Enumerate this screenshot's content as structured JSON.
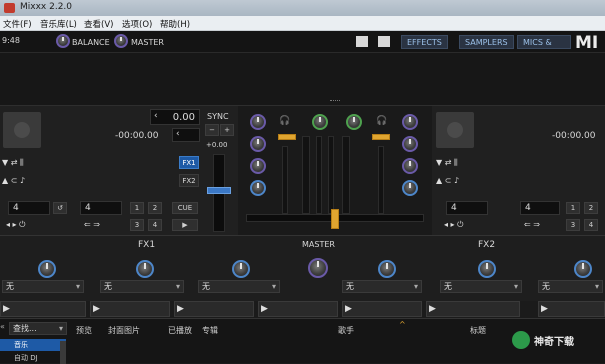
{
  "window": {
    "title": "Mixxx 2.2.0"
  },
  "menu": [
    {
      "label": "文件(F)"
    },
    {
      "label": "音乐库(L)"
    },
    {
      "label": "查看(V)"
    },
    {
      "label": "选项(O)"
    },
    {
      "label": "帮助(H)"
    }
  ],
  "topbar": {
    "clock": "9:48",
    "balance": "BALANCE",
    "master": "MASTER",
    "effects": "EFFECTS",
    "samplers": "SAMPLERS",
    "mics_aux": "MICS & AUX",
    "logo": "MI"
  },
  "deck_left": {
    "rate": "0.00",
    "time": "-00:00.00",
    "loop_size": "4",
    "beatjump_size": "4",
    "sync": "SYNC",
    "pitch": "+0.00",
    "fx1": "FX1",
    "fx2": "FX2",
    "cue": "CUE",
    "hotcues": [
      "1",
      "2",
      "3",
      "4"
    ]
  },
  "deck_right": {
    "time": "-00:00.00",
    "loop_size": "4",
    "beatjump_size": "4",
    "hotcues": [
      "1",
      "2",
      "3",
      "4"
    ]
  },
  "fx": {
    "unit1": "FX1",
    "unit2": "FX2",
    "master": "MASTER",
    "none": "无"
  },
  "library": {
    "search_placeholder": "查找...",
    "columns": [
      "预览",
      "封面图片",
      "已播放",
      "专辑",
      "歌手",
      "标题"
    ],
    "tree": [
      "音乐",
      "自动 DJ"
    ],
    "watermark": "神奇下载"
  },
  "colors": {
    "accent": "#e0a530",
    "blue": "#1e5aa6"
  }
}
